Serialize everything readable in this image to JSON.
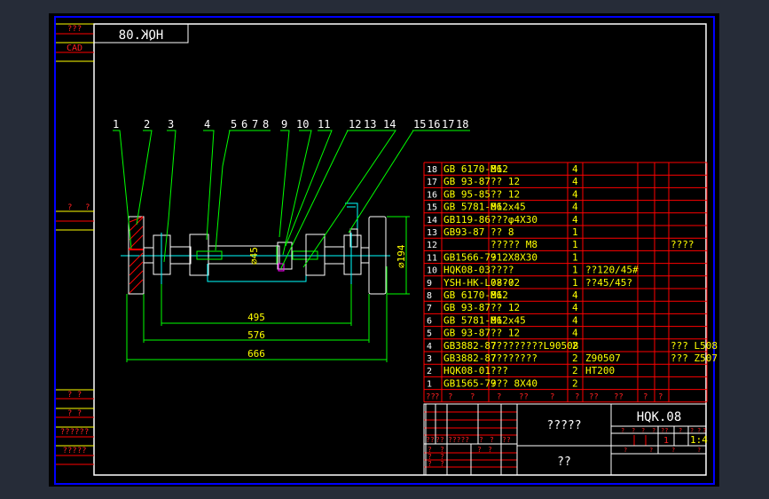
{
  "colors": {
    "frame": "#0000ff",
    "border": "#ffffff",
    "table": "#ff0000",
    "text": "#ffff00",
    "leader": "#00ff00",
    "center": "#00ffff"
  },
  "left_strip": {
    "top_label": "???",
    "cad_label": "CAD",
    "mid_marks": [
      "?",
      "?"
    ],
    "bottom_labels": [
      "? ?",
      "? ?",
      "??????",
      "?????"
    ]
  },
  "mirrored_title": "HQK.08",
  "balloons": [
    "1",
    "2",
    "3",
    "4",
    "5",
    "6",
    "7",
    "8",
    "9",
    "10",
    "11",
    "12",
    "13",
    "14",
    "15",
    "16",
    "17",
    "18"
  ],
  "dimensions": {
    "inner": "495",
    "middle": "576",
    "overall": "666",
    "wheel_dia": "⌀194",
    "shaft_dia": "⌀45"
  },
  "parts": [
    {
      "no": "18",
      "code": "GB 6170-86",
      "name": "M12",
      "qty": "4",
      "material": "",
      "note": ""
    },
    {
      "no": "17",
      "code": "GB 93-87",
      "name": "?? 12",
      "qty": "4",
      "material": "",
      "note": ""
    },
    {
      "no": "16",
      "code": "GB 95-85",
      "name": "?? 12",
      "qty": "4",
      "material": "",
      "note": ""
    },
    {
      "no": "15",
      "code": "GB 5781-86",
      "name": "M12x45",
      "qty": "4",
      "material": "",
      "note": ""
    },
    {
      "no": "14",
      "code": "GB119-86",
      "name": "???φ4X30",
      "qty": "4",
      "material": "",
      "note": ""
    },
    {
      "no": "13",
      "code": "GB93-87",
      "name": "?? 8",
      "qty": "1",
      "material": "",
      "note": ""
    },
    {
      "no": "12",
      "code": "",
      "name": "????? M8",
      "qty": "1",
      "material": "",
      "note": "????"
    },
    {
      "no": "11",
      "code": "GB1566-79",
      "name": "?12X8X30",
      "qty": "1",
      "material": "",
      "note": ""
    },
    {
      "no": "10",
      "code": "HQK08-03",
      "name": "????",
      "qty": "1",
      "material": "??120/45#",
      "note": ""
    },
    {
      "no": "9",
      "code": "YSH-HK-L08-02",
      "name": "????",
      "qty": "1",
      "material": "??45/45?",
      "note": ""
    },
    {
      "no": "8",
      "code": "GB 6170-86",
      "name": "M12",
      "qty": "4",
      "material": "",
      "note": ""
    },
    {
      "no": "7",
      "code": "GB 93-87",
      "name": "?? 12",
      "qty": "4",
      "material": "",
      "note": ""
    },
    {
      "no": "6",
      "code": "GB 5781-86",
      "name": "M12x45",
      "qty": "4",
      "material": "",
      "note": ""
    },
    {
      "no": "5",
      "code": "GB 93-87",
      "name": "?? 12",
      "qty": "4",
      "material": "",
      "note": ""
    },
    {
      "no": "4",
      "code": "GB3882-87",
      "name": "?????????L90508",
      "qty": "2",
      "material": "",
      "note": "??? L508"
    },
    {
      "no": "3",
      "code": "GB3882-87",
      "name": "????????",
      "qty": "2",
      "material": "Z90507",
      "note": "??? Z507"
    },
    {
      "no": "2",
      "code": "HQK08-01",
      "name": "???",
      "qty": "2",
      "material": "HT200",
      "note": ""
    },
    {
      "no": "1",
      "code": "GB1565-79",
      "name": "??? 8X40",
      "qty": "2",
      "material": "",
      "note": ""
    }
  ],
  "parts_header": [
    "??",
    "?",
    "?",
    "?",
    "?",
    "??",
    "?",
    "?",
    "??",
    "??",
    "?",
    "?"
  ],
  "title_block": {
    "drawing_name": "?????",
    "drawing_no": "HQK.08",
    "company": "??",
    "scale": "1:4",
    "sheet_count": "1",
    "left_labels": [
      "??",
      "??",
      "?????",
      "?",
      "?",
      "??"
    ],
    "sign_labels": [
      "?",
      "?",
      "?",
      "?",
      "?",
      "?",
      "?",
      "?"
    ],
    "mid_labels": [
      "?",
      "?",
      "?",
      "?",
      "??",
      "?",
      "?",
      "?",
      "?"
    ],
    "bottom_labels": [
      "?",
      "?",
      "?",
      "?"
    ]
  }
}
